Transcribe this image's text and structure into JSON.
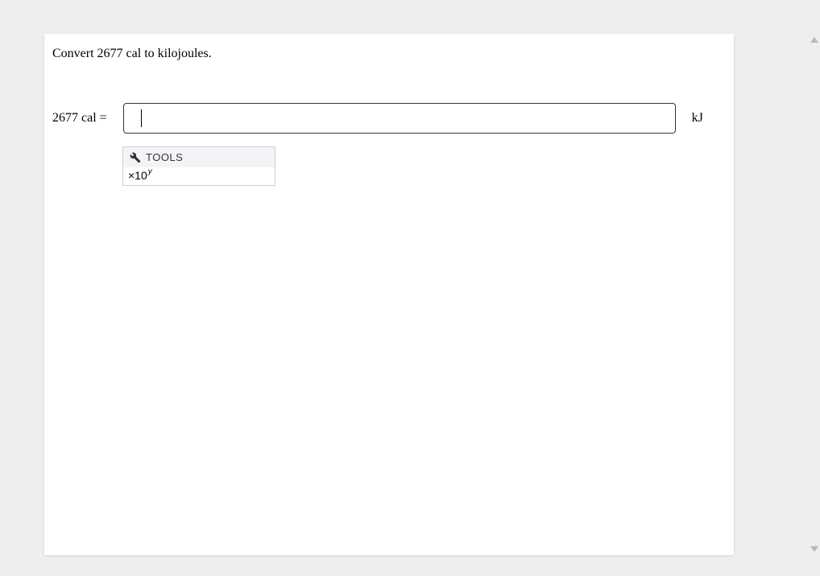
{
  "question": {
    "prompt": "Convert 2677 cal to kilojoules."
  },
  "equation": {
    "lhs": "2677 cal  =",
    "input_value": "",
    "unit": "kJ"
  },
  "tools": {
    "header": "TOOLS",
    "sci_notation_base": "×10",
    "sci_notation_exp": "y"
  }
}
